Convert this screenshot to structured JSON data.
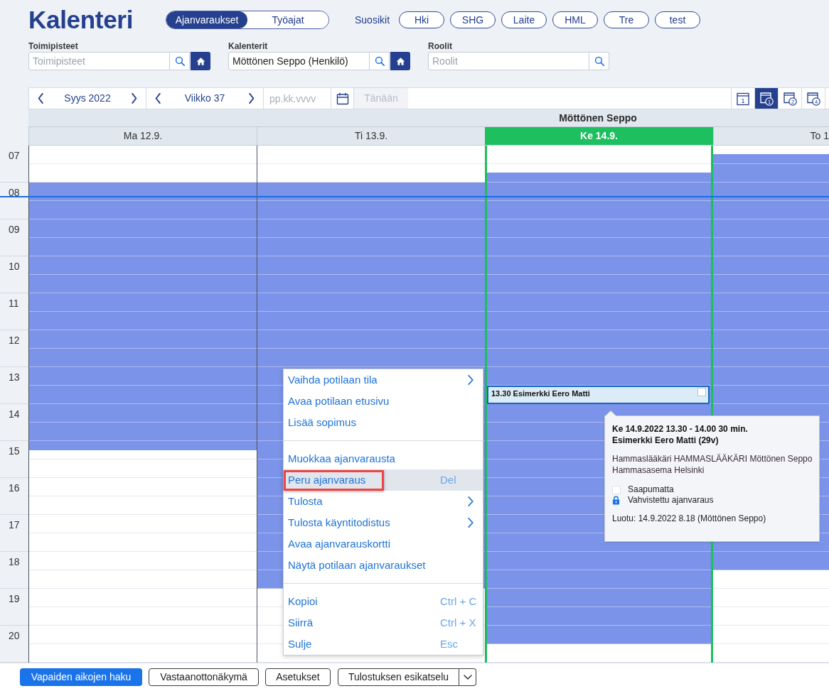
{
  "header": {
    "title": "Kalenteri",
    "view_tabs": [
      {
        "label": "Ajanvaraukset",
        "selected": true
      },
      {
        "label": "Työajat",
        "selected": false
      }
    ],
    "favorites_label": "Suosikit",
    "favorites": [
      "Hki",
      "SHG",
      "Laite",
      "HML",
      "Tre",
      "test"
    ]
  },
  "filters": [
    {
      "label": "Toimipisteet",
      "placeholder": "Toimipisteet",
      "home_button": true
    },
    {
      "label": "Kalenterit",
      "value": "Möttönen Seppo (Henkilö)",
      "home_button": true
    },
    {
      "label": "Roolit",
      "placeholder": "Roolit",
      "home_button": false
    }
  ],
  "toolbar": {
    "month": "Syys 2022",
    "week": "Viikko 37",
    "date_field": {
      "placeholder": "pp.kk.vvvv"
    },
    "today_button": {
      "label": "Tänään",
      "disabled": true
    },
    "view_modes": [
      {
        "kind": "plain",
        "label": "1",
        "selected": false
      },
      {
        "kind": "badge",
        "label": "1",
        "selected": true
      },
      {
        "kind": "badge",
        "label": "2",
        "selected": false
      },
      {
        "kind": "badge",
        "label": "4",
        "selected": false
      }
    ]
  },
  "calendar": {
    "resource": "Möttönen Seppo",
    "hours": [
      {
        "label": "07",
        "now": false
      },
      {
        "label": "08",
        "now": true
      },
      {
        "label": "09",
        "now": false
      },
      {
        "label": "10",
        "now": false
      },
      {
        "label": "11",
        "now": false
      },
      {
        "label": "12",
        "now": false
      },
      {
        "label": "13",
        "now": false
      },
      {
        "label": "14",
        "now": false
      },
      {
        "label": "15",
        "now": false
      },
      {
        "label": "16",
        "now": false
      },
      {
        "label": "17",
        "now": false
      },
      {
        "label": "18",
        "now": false
      },
      {
        "label": "19",
        "now": false
      },
      {
        "label": "20",
        "now": false
      }
    ],
    "days": [
      {
        "label": "Ma 12.9.",
        "today": false,
        "slots": [
          {
            "kind": "closed"
          },
          {
            "kind": "closed"
          },
          {
            "kind": "open"
          },
          {
            "kind": "open"
          },
          {
            "kind": "open"
          },
          {
            "kind": "open"
          },
          {
            "kind": "open"
          },
          {
            "kind": "open"
          },
          {
            "kind": "open"
          },
          {
            "kind": "open"
          },
          {
            "kind": "open"
          },
          {
            "kind": "open"
          },
          {
            "kind": "open"
          },
          {
            "kind": "open"
          },
          {
            "kind": "open"
          },
          {
            "kind": "open"
          },
          {
            "kind": "closing"
          },
          {
            "kind": "closed"
          },
          {
            "kind": "closed"
          },
          {
            "kind": "closed"
          },
          {
            "kind": "closed"
          },
          {
            "kind": "closed"
          },
          {
            "kind": "closed"
          },
          {
            "kind": "closed"
          },
          {
            "kind": "closed"
          },
          {
            "kind": "closed"
          },
          {
            "kind": "closed"
          },
          {
            "kind": "closed"
          }
        ]
      },
      {
        "label": "Ti 13.9.",
        "today": false,
        "slots": [
          {
            "kind": "closed"
          },
          {
            "kind": "closed"
          },
          {
            "kind": "open"
          },
          {
            "kind": "open"
          },
          {
            "kind": "open"
          },
          {
            "kind": "open"
          },
          {
            "kind": "open"
          },
          {
            "kind": "open"
          },
          {
            "kind": "open"
          },
          {
            "kind": "open"
          },
          {
            "kind": "open"
          },
          {
            "kind": "open"
          },
          {
            "kind": "open"
          },
          {
            "kind": "open"
          },
          {
            "kind": "open"
          },
          {
            "kind": "open"
          },
          {
            "kind": "open"
          },
          {
            "kind": "open"
          },
          {
            "kind": "open"
          },
          {
            "kind": "open"
          },
          {
            "kind": "open"
          },
          {
            "kind": "open"
          },
          {
            "kind": "open"
          },
          {
            "kind": "open"
          },
          {
            "kind": "closed"
          },
          {
            "kind": "closed"
          },
          {
            "kind": "closed"
          },
          {
            "kind": "closed"
          }
        ]
      },
      {
        "label": "Ke 14.9.",
        "today": true,
        "slots": [
          {
            "kind": "closed"
          },
          {
            "kind": "opening"
          },
          {
            "kind": "open"
          },
          {
            "kind": "open"
          },
          {
            "kind": "open"
          },
          {
            "kind": "open"
          },
          {
            "kind": "open"
          },
          {
            "kind": "open"
          },
          {
            "kind": "open"
          },
          {
            "kind": "open"
          },
          {
            "kind": "open"
          },
          {
            "kind": "open"
          },
          {
            "kind": "open"
          },
          {
            "kind": "open",
            "event": {
              "label": "13.30 Esimerkki Eero Matti",
              "checked": false
            }
          },
          {
            "kind": "open"
          },
          {
            "kind": "open"
          },
          {
            "kind": "open"
          },
          {
            "kind": "open"
          },
          {
            "kind": "open"
          },
          {
            "kind": "open"
          },
          {
            "kind": "open"
          },
          {
            "kind": "open"
          },
          {
            "kind": "open"
          },
          {
            "kind": "open"
          },
          {
            "kind": "open"
          },
          {
            "kind": "open"
          },
          {
            "kind": "open"
          },
          {
            "kind": "closed"
          }
        ]
      },
      {
        "label": "To 1",
        "today": false,
        "slots": [
          {
            "kind": "opening"
          },
          {
            "kind": "open"
          },
          {
            "kind": "open"
          },
          {
            "kind": "open"
          },
          {
            "kind": "open"
          },
          {
            "kind": "open"
          },
          {
            "kind": "open"
          },
          {
            "kind": "open"
          },
          {
            "kind": "open"
          },
          {
            "kind": "open"
          },
          {
            "kind": "open"
          },
          {
            "kind": "open"
          },
          {
            "kind": "open"
          },
          {
            "kind": "open"
          },
          {
            "kind": "open"
          },
          {
            "kind": "open"
          },
          {
            "kind": "open"
          },
          {
            "kind": "open"
          },
          {
            "kind": "open"
          },
          {
            "kind": "open"
          },
          {
            "kind": "open"
          },
          {
            "kind": "open"
          },
          {
            "kind": "open"
          },
          {
            "kind": "closed"
          },
          {
            "kind": "closed"
          },
          {
            "kind": "closed"
          },
          {
            "kind": "closed"
          },
          {
            "kind": "closed"
          }
        ]
      }
    ]
  },
  "context_menu": {
    "groups": [
      {
        "items": [
          {
            "label": "Vaihda potilaan tila",
            "submenu": true,
            "selected": false,
            "marked": false
          },
          {
            "label": "Avaa potilaan etusivu",
            "submenu": false,
            "selected": false,
            "marked": false
          },
          {
            "label": "Lisää sopimus",
            "submenu": false,
            "selected": false,
            "marked": false
          }
        ]
      },
      {
        "items": [
          {
            "label": "Muokkaa ajanvarausta",
            "submenu": false,
            "selected": false,
            "marked": false
          },
          {
            "label": "Peru ajanvaraus",
            "shortcut": "Del",
            "submenu": false,
            "selected": true,
            "marked": true
          },
          {
            "label": "Tulosta",
            "submenu": true,
            "selected": false,
            "marked": false
          },
          {
            "label": "Tulosta käyntitodistus",
            "submenu": true,
            "selected": false,
            "marked": false
          },
          {
            "label": "Avaa ajanvarauskortti",
            "submenu": false,
            "selected": false,
            "marked": false
          },
          {
            "label": "Näytä potilaan ajanvaraukset",
            "submenu": false,
            "selected": false,
            "marked": false
          }
        ]
      },
      {
        "items": [
          {
            "label": "Kopioi",
            "shortcut": "Ctrl + C",
            "submenu": false,
            "selected": false,
            "marked": false
          },
          {
            "label": "Siirrä",
            "shortcut": "Ctrl + X",
            "submenu": false,
            "selected": false,
            "marked": false
          },
          {
            "label": "Sulje",
            "shortcut": "Esc",
            "submenu": false,
            "selected": false,
            "marked": false
          }
        ]
      }
    ]
  },
  "tooltip": {
    "title": "Ke 14.9.2022 13.30 - 14.00 30 min.",
    "patient": "Esimerkki Eero Matti (29v)",
    "details": [
      "Hammaslääkäri HAMMASLÄÄKÄRI Möttönen Seppo",
      "Hammasasema Helsinki"
    ],
    "statuses": [
      {
        "kind": "box",
        "label": "Saapumatta"
      },
      {
        "kind": "lock",
        "label": "Vahvistettu ajanvaraus"
      }
    ],
    "created": "Luotu: 14.9.2022 8.18 (Möttönen Seppo)"
  },
  "bottom_bar": {
    "buttons": [
      {
        "label": "Vapaiden aikojen haku",
        "kind": "primary"
      },
      {
        "label": "Vastaanottonäkymä",
        "kind": "outline"
      },
      {
        "label": "Asetukset",
        "kind": "outline"
      },
      {
        "label": "Tulostuksen esikatselu",
        "kind": "split"
      }
    ]
  }
}
